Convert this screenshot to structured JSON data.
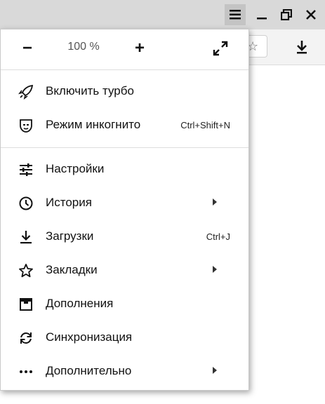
{
  "window": {
    "menu_icon": "hamburger-icon",
    "minimize_icon": "minimize-icon",
    "restore_icon": "restore-icon",
    "close_icon": "close-icon"
  },
  "toolbar": {
    "bookmark_icon": "star-icon",
    "downloads_icon": "download-icon"
  },
  "menu": {
    "zoom": {
      "minus": "−",
      "value": "100 %",
      "plus": "+",
      "fullscreen_icon": "fullscreen-icon"
    },
    "items": [
      {
        "label": "Включить турбо",
        "icon": "rocket-icon"
      },
      {
        "label": "Режим инкогнито",
        "icon": "incognito-icon",
        "shortcut": "Ctrl+Shift+N"
      },
      {
        "label": "Настройки",
        "icon": "settings-sliders-icon"
      },
      {
        "label": "История",
        "icon": "clock-icon"
      },
      {
        "label": "Загрузки",
        "icon": "download-icon",
        "shortcut": "Ctrl+J"
      },
      {
        "label": "Закладки",
        "icon": "star-icon"
      },
      {
        "label": "Дополнения",
        "icon": "addons-icon"
      },
      {
        "label": "Синхронизация",
        "icon": "sync-icon"
      },
      {
        "label": "Дополнительно",
        "icon": "more-icon"
      }
    ]
  }
}
